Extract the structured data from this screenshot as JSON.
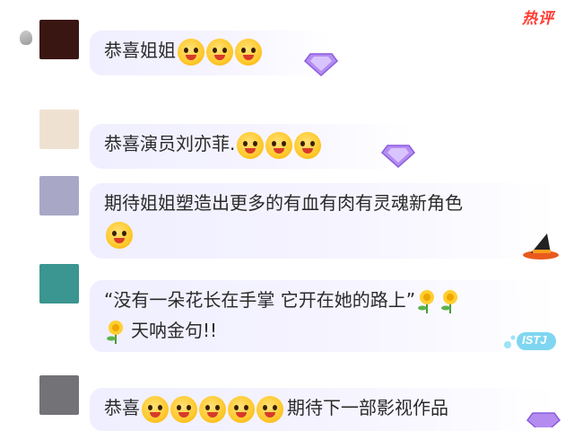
{
  "hot_tag": "热评",
  "comments": [
    {
      "avatar_color": "#3a1612",
      "text": "恭喜姐姐",
      "trail_text": "",
      "line2_text": "",
      "emojis": [
        "grinning-flower-emoji",
        "grinning-flower-emoji",
        "grinning-flower-emoji"
      ],
      "badge": "diamond-badge"
    },
    {
      "avatar_color": "#efe1d2",
      "text": "恭喜演员刘亦菲.",
      "trail_text": "",
      "line2_text": "",
      "emojis": [
        "hearts-emoji",
        "hearts-emoji",
        "hearts-emoji"
      ],
      "badge": "diamond-badge"
    },
    {
      "avatar_color": "#a9a7c6",
      "text": "期待姐姐塑造出更多的有血有肉有灵魂新角色",
      "trail_text": "",
      "line2_text": "",
      "emojis": [
        "grinning-flower-emoji"
      ],
      "badge": "witch-hat-badge"
    },
    {
      "avatar_color": "#3b9590",
      "text": "“没有一朵花长在手掌 它开在她的路上”",
      "trail_text": "",
      "line2_text": "天呐金句!!",
      "emojis": [
        "flower-emoji",
        "flower-emoji",
        "flower-emoji"
      ],
      "badge": "istj-badge"
    },
    {
      "avatar_color": "#727277",
      "text": "恭喜",
      "trail_text": "期待下一部影视作品",
      "line2_text": "",
      "emojis": [
        "kiss-emoji",
        "kiss-emoji",
        "kiss-emoji",
        "kiss-emoji",
        "kiss-emoji"
      ],
      "badge": "diamond-badge"
    }
  ],
  "badge_labels": {
    "istj": "ISTJ"
  }
}
